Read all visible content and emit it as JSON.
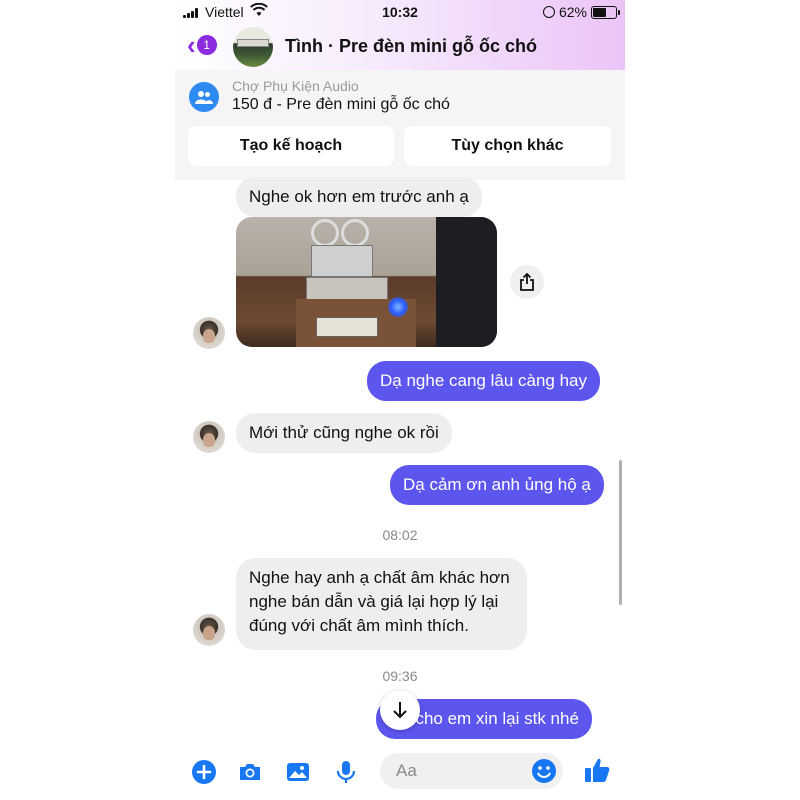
{
  "status_bar": {
    "carrier": "Viettel",
    "time": "10:32",
    "battery": "62%",
    "battery_level": 0.62
  },
  "header": {
    "back_badge": "1",
    "title": "Tình · Pre đèn mini gỗ ốc chó"
  },
  "marketplace": {
    "shop_name": "Chợ Phụ Kiện Audio",
    "listing": "150 đ - Pre đèn mini gỗ ốc chó",
    "buttons": {
      "plan": "Tạo kế hoạch",
      "options": "Tùy chọn khác"
    }
  },
  "messages": [
    {
      "from": "other",
      "text": "Nghe ok hơn em trước anh ạ"
    },
    {
      "from": "me",
      "text": "Dạ nghe cang lâu càng hay"
    },
    {
      "from": "other",
      "text": "Mới thử cũng nghe ok rồi"
    },
    {
      "from": "me",
      "text": "Dạ cảm ơn anh ủng hộ ạ"
    },
    {
      "from": "other",
      "lines": [
        "Nghe hay anh ạ chất âm khác hơn",
        "nghe bán dẫn và giá lại hợp lý lại",
        "đúng với chất âm mình thích."
      ]
    },
    {
      "from": "me",
      "text": "Dạ cho em xin lại stk nhé"
    }
  ],
  "timestamps": [
    "08:02",
    "09:36"
  ],
  "composer": {
    "placeholder": "Aa"
  },
  "colors": {
    "accent": "#8a2be2",
    "outgoing_bubble": "#5c55ee",
    "icon_blue": "#1877f2"
  }
}
